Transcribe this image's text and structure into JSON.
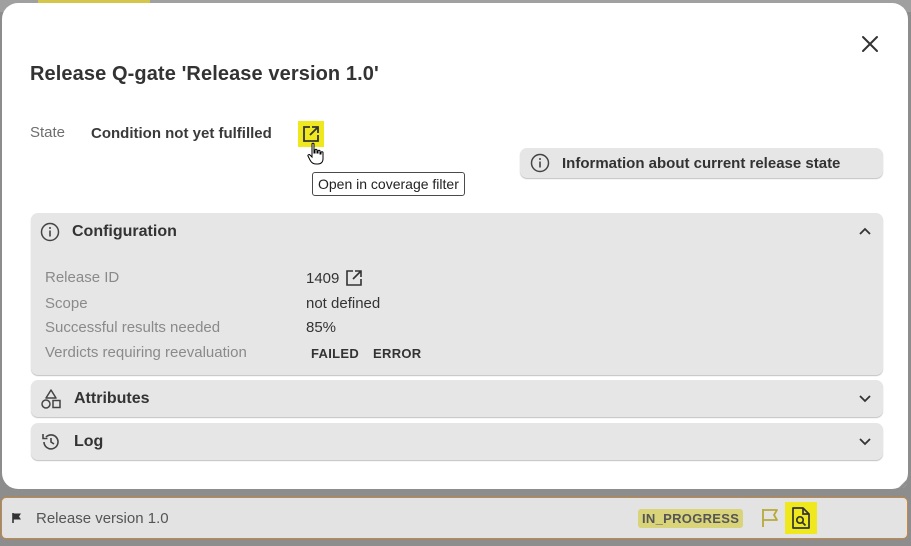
{
  "modal": {
    "title": "Release Q-gate 'Release version 1.0'",
    "state": {
      "label": "State",
      "value": "Condition not yet fulfilled"
    },
    "tooltip": "Open in coverage filter",
    "info_button_label": "Information about current release state",
    "configuration": {
      "title": "Configuration",
      "expanded": true,
      "rows": [
        {
          "label": "Release ID",
          "value": "1409"
        },
        {
          "label": "Scope",
          "value": "not defined"
        },
        {
          "label": "Successful results needed",
          "value": "85%"
        },
        {
          "label": "Verdicts requiring reevaluation",
          "verdicts": [
            "FAILED",
            "ERROR"
          ]
        }
      ]
    },
    "attributes": {
      "title": "Attributes",
      "expanded": false
    },
    "log": {
      "title": "Log",
      "expanded": false
    }
  },
  "bottom_bar": {
    "release_name": "Release version 1.0",
    "status": "IN_PROGRESS"
  },
  "colors": {
    "highlight": "#f0e81f",
    "panel_bg": "#e6e6e6",
    "overlay": "#8d8d8d",
    "bottom_border": "#c8873f"
  }
}
